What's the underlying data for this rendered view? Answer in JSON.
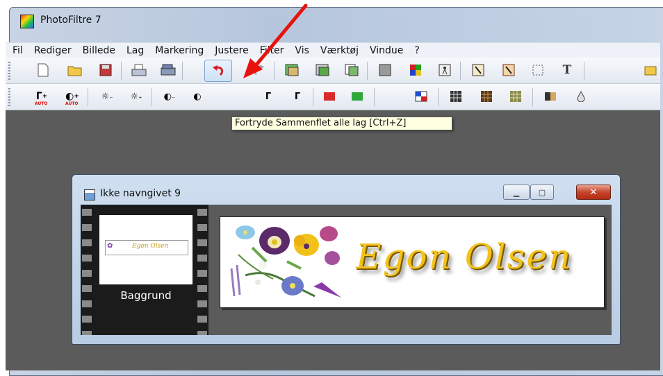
{
  "app": {
    "title": "PhotoFiltre 7"
  },
  "menu": [
    "Fil",
    "Rediger",
    "Billede",
    "Lag",
    "Markering",
    "Justere",
    "Filter",
    "Vis",
    "Værktøj",
    "Vindue",
    "?"
  ],
  "toolbar": {
    "buttons": [
      "new-file",
      "open-file",
      "save",
      "print",
      "scan",
      "undo",
      "redo",
      "paste-as-image",
      "paste-transparent",
      "duplicate",
      "fill-gray",
      "color-palette",
      "magic-wand",
      "stamp",
      "layer-text",
      "selection",
      "text"
    ]
  },
  "adjust_toolbar": {
    "gamma_auto": "AUTO",
    "contrast_auto": "AUTO"
  },
  "tooltip": {
    "text": "Fortryde Sammenflet alle lag [Ctrl+Z]"
  },
  "document": {
    "title": "Ikke navngivet 9",
    "layer_name": "Baggrund",
    "canvas_text": "Egon Olsen",
    "thumb_text": "Egon Olsen"
  },
  "colors": {
    "accent_arrow": "#e8120c",
    "canvas_text": "#f3c21a",
    "workspace": "#5b5b5b"
  }
}
